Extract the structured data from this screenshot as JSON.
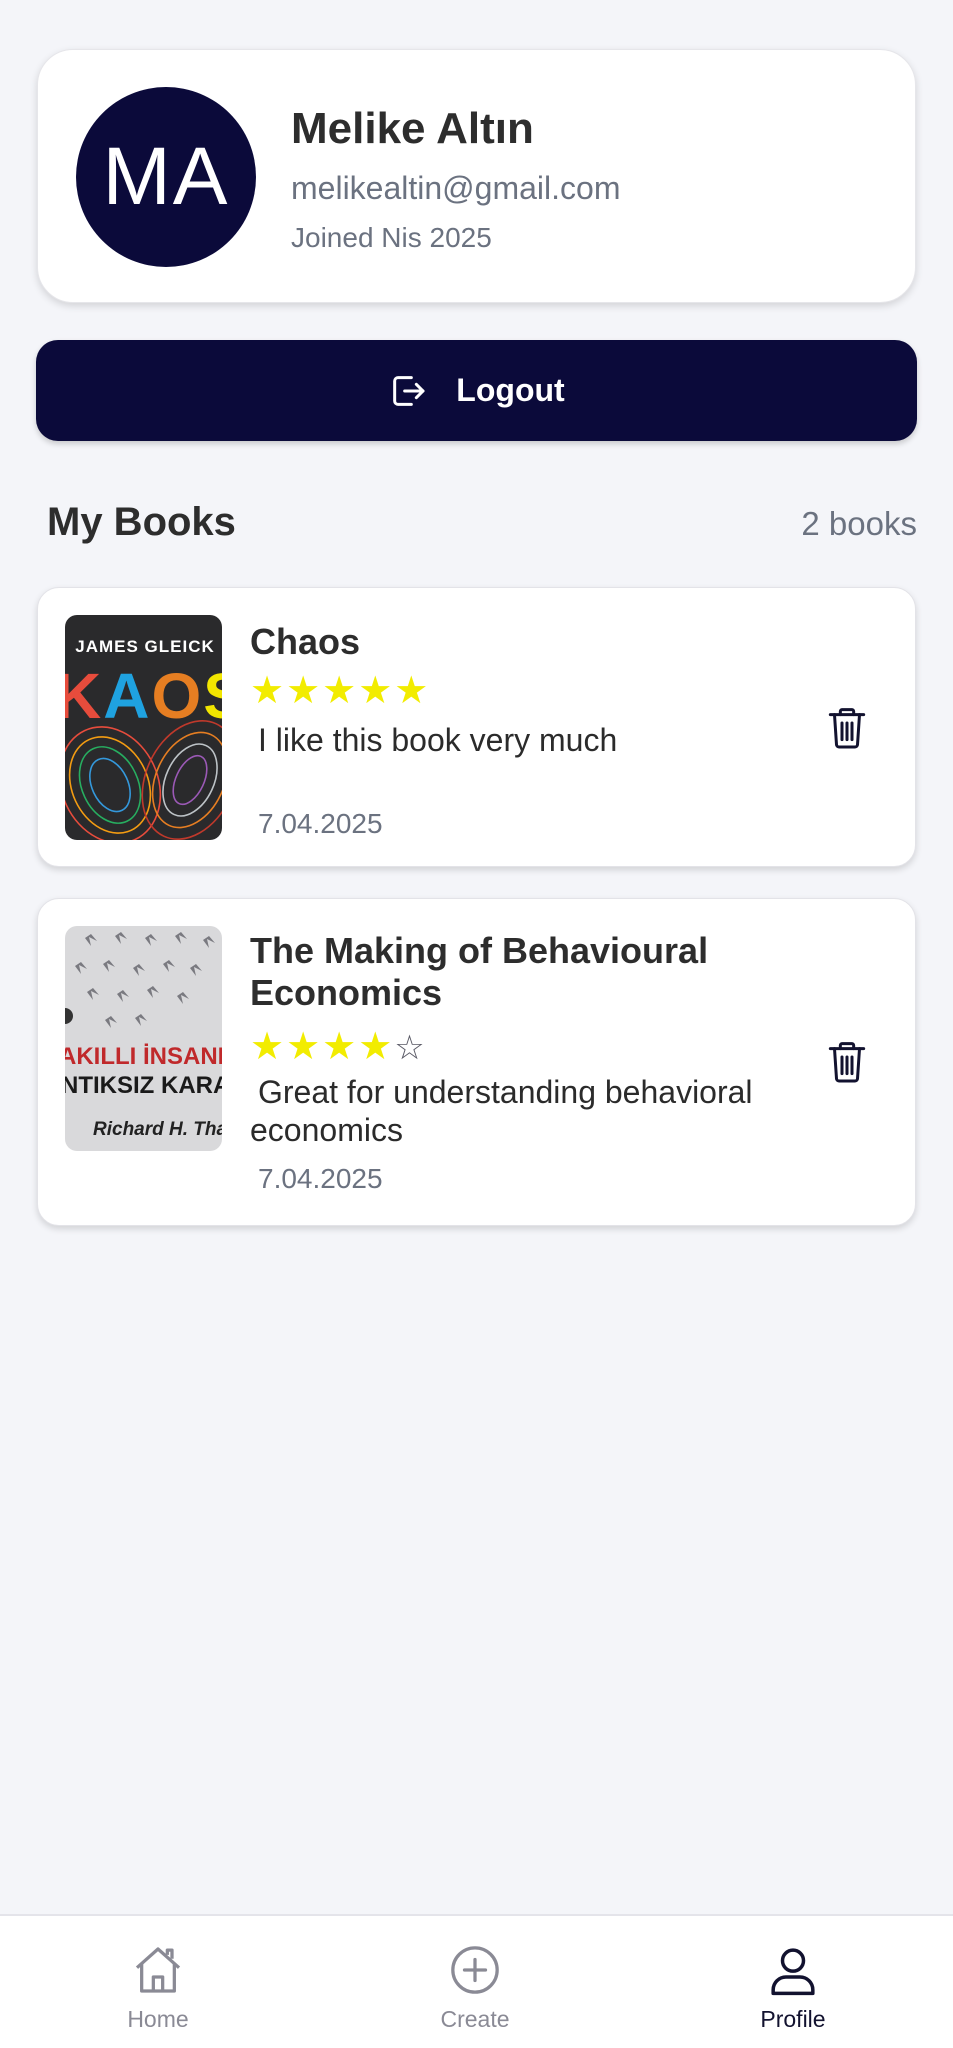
{
  "profile": {
    "initials": "MA",
    "name": "Melike Altın",
    "email": "melikealtin@gmail.com",
    "joined": "Joined Nis 2025",
    "avatar_color": "#0b0a3a"
  },
  "logout": {
    "label": "Logout",
    "icon": "logout-icon"
  },
  "section": {
    "title": "My Books",
    "count": "2 books"
  },
  "books": [
    {
      "title": "Chaos",
      "rating": 5,
      "stars_full": "★★★★★",
      "stars_empty": "",
      "review": "I like this book very much",
      "date": "7.04.2025",
      "cover": {
        "author": "JAMES GLEICK",
        "title": "KAOS"
      }
    },
    {
      "title": "The Making of Behavioural Economics",
      "rating": 4,
      "stars_full": "★★★★",
      "stars_empty": "☆",
      "review": "Great for understanding behavioral economics",
      "date": "7.04.2025",
      "cover": {
        "line1": "AKILLI İNSANLAR",
        "line2": "NTIKSIZ KARARLA",
        "author": "Richard H. Tha"
      }
    }
  ],
  "nav": {
    "items": [
      {
        "label": "Home",
        "icon": "home-icon",
        "active": false
      },
      {
        "label": "Create",
        "icon": "plus-circle-icon",
        "active": false
      },
      {
        "label": "Profile",
        "icon": "person-icon",
        "active": true
      }
    ]
  },
  "colors": {
    "background": "#f4f5f9",
    "primary": "#0b0a3a",
    "star": "#f2ec00",
    "muted": "#6b7280"
  }
}
